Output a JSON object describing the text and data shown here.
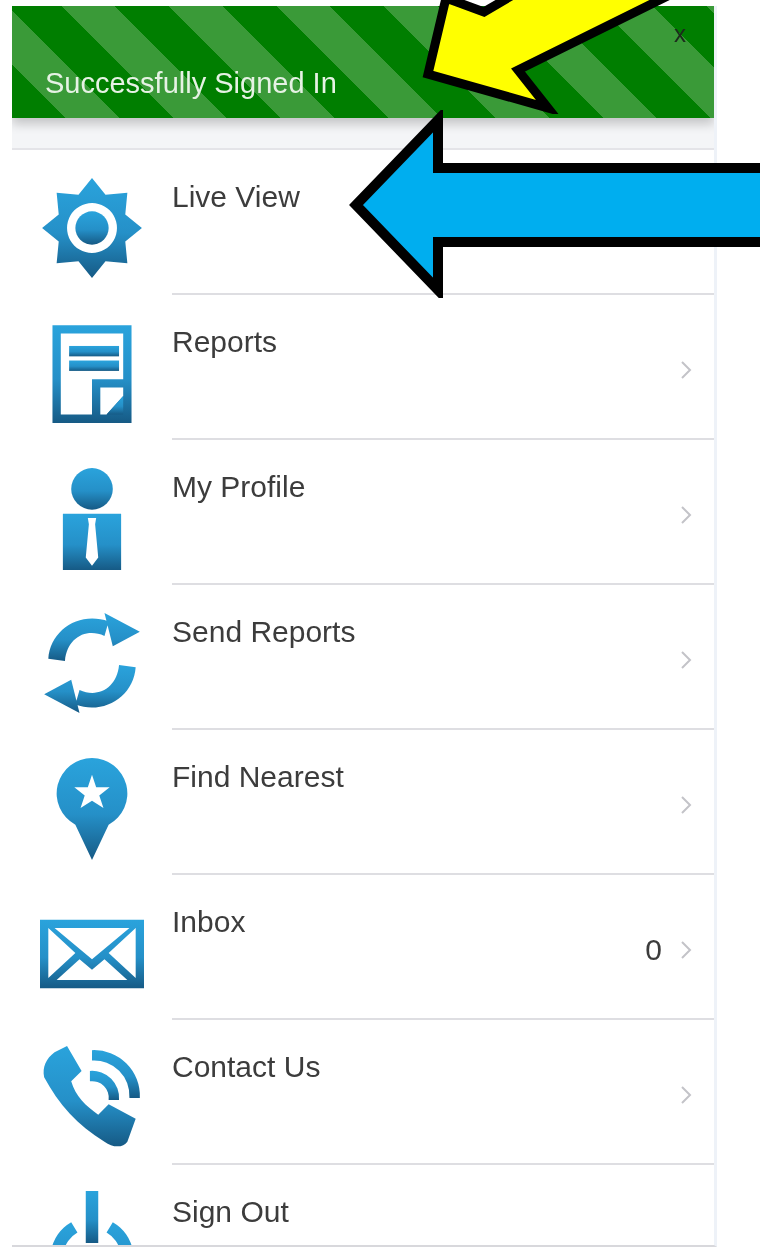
{
  "banner": {
    "message": "Successfully Signed In",
    "close": "x"
  },
  "menu": {
    "items": [
      {
        "kind": "live-view",
        "label": "Live View",
        "chevron": false
      },
      {
        "kind": "reports",
        "label": "Reports",
        "chevron": true
      },
      {
        "kind": "profile",
        "label": "My Profile",
        "chevron": true
      },
      {
        "kind": "sync",
        "label": "Send Reports",
        "chevron": true
      },
      {
        "kind": "location",
        "label": "Find Nearest",
        "chevron": true
      },
      {
        "kind": "inbox",
        "label": "Inbox",
        "count": "0",
        "chevron": true
      },
      {
        "kind": "contact",
        "label": "Contact Us",
        "chevron": true
      },
      {
        "kind": "sign-out",
        "label": "Sign Out",
        "chevron": false
      }
    ]
  },
  "annotations": [
    {
      "color": "#ffff00"
    },
    {
      "color": "#00aeef"
    }
  ]
}
